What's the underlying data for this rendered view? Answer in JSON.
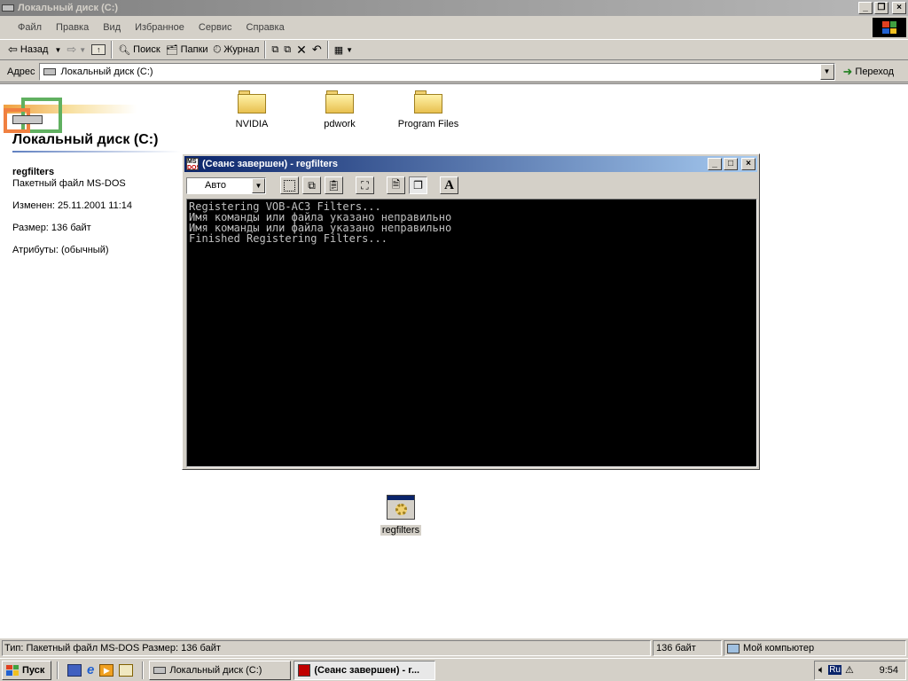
{
  "explorer": {
    "title": "Локальный диск (C:)",
    "menu": [
      "Файл",
      "Правка",
      "Вид",
      "Избранное",
      "Сервис",
      "Справка"
    ],
    "toolbar": {
      "back": "Назад",
      "search": "Поиск",
      "folders": "Папки",
      "history": "Журнал"
    },
    "address_label": "Адрес",
    "address_value": "Локальный диск (C:)",
    "go_label": "Переход"
  },
  "left_panel": {
    "heading": "Локальный диск (C:)",
    "file_name": "regfilters",
    "file_type": "Пакетный файл MS-DOS",
    "modified": "Изменен: 25.11.2001 11:14",
    "size": "Размер: 136 байт",
    "attributes": "Атрибуты: (обычный)"
  },
  "folders": [
    "NVIDIA",
    "pdwork",
    "Program Files"
  ],
  "file_icon_label": "regfilters",
  "dos_window": {
    "title": "(Сеанс завершен) - regfilters",
    "font_select": "Авто",
    "lines": [
      "Registering VOB-AC3 Filters...",
      "Имя команды или файла указано неправильно",
      "Имя команды или файла указано неправильно",
      "Finished Registering Filters..."
    ]
  },
  "statusbar": {
    "info": "Тип: Пакетный файл MS-DOS Размер: 136 байт",
    "size": "136 байт",
    "zone": "Мой компьютер"
  },
  "taskbar": {
    "start": "Пуск",
    "tasks": [
      "Локальный диск (C:)",
      "(Сеанс завершен) - r..."
    ],
    "lang": "Ru",
    "clock": "9:54"
  },
  "colors": {
    "title_active": "#0a246a",
    "title_inactive": "#808080",
    "console_bg": "#000000",
    "console_fg": "#c0c0c0"
  }
}
